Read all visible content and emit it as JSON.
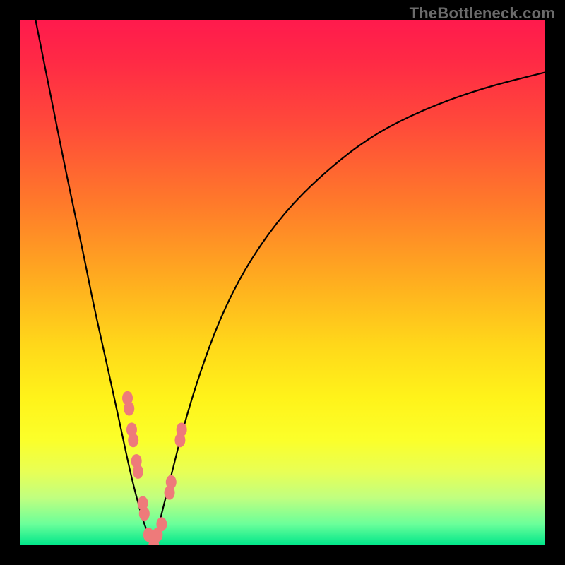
{
  "watermark": "TheBottleneck.com",
  "colors": {
    "frame": "#000000",
    "curve": "#000000",
    "marker": "#ee7a7a",
    "gradient_top": "#ff1a4d",
    "gradient_bottom": "#00e68a"
  },
  "chart_data": {
    "type": "line",
    "title": "",
    "xlabel": "",
    "ylabel": "",
    "xlim": [
      0,
      100
    ],
    "ylim": [
      0,
      100
    ],
    "grid": false,
    "series": [
      {
        "name": "left-curve",
        "x": [
          3,
          6,
          9,
          12,
          14,
          16,
          18,
          19.5,
          21,
          22.5,
          24,
          25.5
        ],
        "y": [
          100,
          85,
          70,
          56,
          46,
          37,
          28,
          21,
          14,
          8,
          3,
          0
        ]
      },
      {
        "name": "right-curve",
        "x": [
          25.5,
          27,
          29,
          31,
          34,
          38,
          43,
          50,
          58,
          67,
          77,
          88,
          100
        ],
        "y": [
          0,
          6,
          14,
          22,
          32,
          43,
          53,
          63,
          71,
          78,
          83,
          87,
          90
        ]
      }
    ],
    "markers": {
      "name": "highlight-points",
      "points": [
        {
          "x": 20.5,
          "y": 28
        },
        {
          "x": 20.8,
          "y": 26
        },
        {
          "x": 21.3,
          "y": 22
        },
        {
          "x": 21.6,
          "y": 20
        },
        {
          "x": 22.2,
          "y": 16
        },
        {
          "x": 22.5,
          "y": 14
        },
        {
          "x": 23.4,
          "y": 8
        },
        {
          "x": 23.7,
          "y": 6
        },
        {
          "x": 24.5,
          "y": 2
        },
        {
          "x": 25.5,
          "y": 0
        },
        {
          "x": 26.2,
          "y": 2
        },
        {
          "x": 27.0,
          "y": 4
        },
        {
          "x": 28.5,
          "y": 10
        },
        {
          "x": 28.8,
          "y": 12
        },
        {
          "x": 30.5,
          "y": 20
        },
        {
          "x": 30.8,
          "y": 22
        }
      ]
    }
  }
}
